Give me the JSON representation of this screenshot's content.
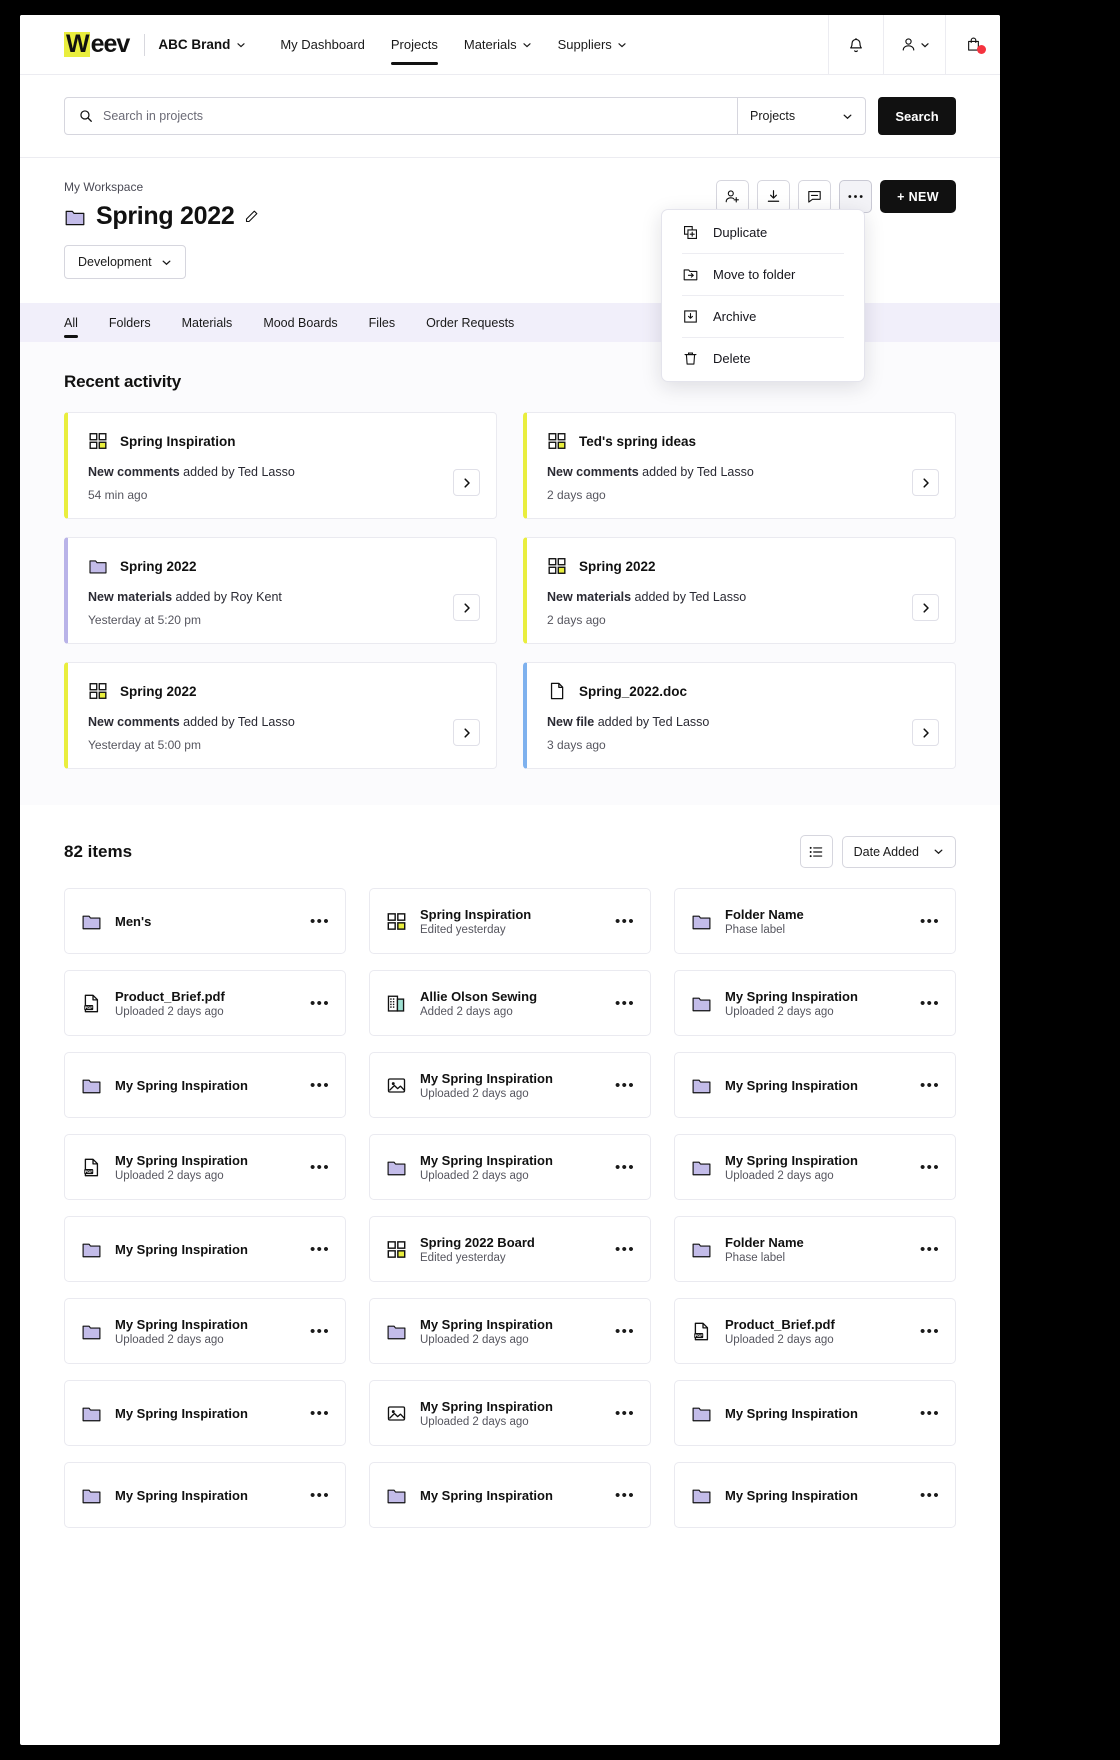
{
  "nav": {
    "logo_w": "W",
    "logo_rest": "eev",
    "brand": "ABC Brand",
    "items": [
      {
        "label": "My Dashboard",
        "caret": false,
        "active": false
      },
      {
        "label": "Projects",
        "caret": false,
        "active": true
      },
      {
        "label": "Materials",
        "caret": true,
        "active": false
      },
      {
        "label": "Suppliers",
        "caret": true,
        "active": false
      }
    ],
    "icons": {
      "bell": "bell-icon",
      "account": "account-icon",
      "bag": "shopping-bag-icon"
    }
  },
  "search": {
    "placeholder": "Search in projects",
    "scope": "Projects",
    "button": "Search"
  },
  "header": {
    "breadcrumb": "My Workspace",
    "title": "Spring 2022",
    "phase": "Development",
    "new_button": "+ NEW",
    "actions": [
      "share-icon",
      "download-icon",
      "comment-icon",
      "more-icon"
    ]
  },
  "dropdown": {
    "items": [
      {
        "label": "Duplicate",
        "icon": "duplicate-icon"
      },
      {
        "label": "Move to folder",
        "icon": "move-to-folder-icon"
      },
      {
        "label": "Archive",
        "icon": "archive-icon"
      },
      {
        "label": "Delete",
        "icon": "trash-icon"
      }
    ]
  },
  "tabs": [
    {
      "label": "All",
      "active": true
    },
    {
      "label": "Folders",
      "active": false
    },
    {
      "label": "Materials",
      "active": false
    },
    {
      "label": "Mood Boards",
      "active": false
    },
    {
      "label": "Files",
      "active": false
    },
    {
      "label": "Order Requests",
      "active": false
    }
  ],
  "recent": {
    "title": "Recent activity",
    "cards": [
      {
        "icon": "moodboard-icon",
        "accent": "yellow",
        "name": "Spring Inspiration",
        "bold": "New comments",
        "rest": " added by Ted Lasso",
        "time": "54 min ago"
      },
      {
        "icon": "moodboard-icon",
        "accent": "yellow",
        "name": "Ted's spring ideas",
        "bold": "New comments",
        "rest": " added by Ted Lasso",
        "time": "2 days ago"
      },
      {
        "icon": "folder-icon",
        "accent": "purple",
        "name": "Spring 2022",
        "bold": "New materials",
        "rest": " added by Roy Kent",
        "time": "Yesterday at 5:20 pm"
      },
      {
        "icon": "moodboard-icon",
        "accent": "yellow",
        "name": "Spring 2022",
        "bold": "New materials",
        "rest": " added by Ted Lasso",
        "time": "2 days ago"
      },
      {
        "icon": "moodboard-icon",
        "accent": "yellow",
        "name": "Spring 2022",
        "bold": "New comments",
        "rest": " added by Ted Lasso",
        "time": "Yesterday at 5:00 pm"
      },
      {
        "icon": "file-icon",
        "accent": "blue",
        "name": "Spring_2022.doc",
        "bold": "New file",
        "rest": " added by Ted Lasso",
        "time": "3 days ago"
      }
    ]
  },
  "items": {
    "count_label": "82 items",
    "view_icon": "list-view-icon",
    "sort_label": "Date Added",
    "cards": [
      {
        "icon": "folder-icon",
        "name": "Men's",
        "sub": ""
      },
      {
        "icon": "moodboard-icon",
        "name": "Spring Inspiration",
        "sub": "Edited yesterday"
      },
      {
        "icon": "folder-icon",
        "name": "Folder Name",
        "sub": "Phase label"
      },
      {
        "icon": "pdf-icon",
        "name": "Product_Brief.pdf",
        "sub": "Uploaded 2 days ago"
      },
      {
        "icon": "supplier-icon",
        "name": "Allie Olson Sewing",
        "sub": "Added 2 days ago"
      },
      {
        "icon": "folder-icon",
        "name": "My Spring Inspiration",
        "sub": "Uploaded 2 days ago"
      },
      {
        "icon": "folder-icon",
        "name": "My Spring Inspiration",
        "sub": ""
      },
      {
        "icon": "image-icon",
        "name": "My Spring Inspiration",
        "sub": "Uploaded 2 days ago"
      },
      {
        "icon": "folder-icon",
        "name": "My Spring Inspiration",
        "sub": ""
      },
      {
        "icon": "pdf-icon",
        "name": "My Spring Inspiration",
        "sub": "Uploaded 2 days ago"
      },
      {
        "icon": "folder-icon",
        "name": "My Spring Inspiration",
        "sub": "Uploaded 2 days ago"
      },
      {
        "icon": "folder-icon",
        "name": "My Spring Inspiration",
        "sub": "Uploaded 2 days ago"
      },
      {
        "icon": "folder-icon",
        "name": "My Spring Inspiration",
        "sub": ""
      },
      {
        "icon": "moodboard-icon",
        "name": "Spring 2022 Board",
        "sub": "Edited yesterday"
      },
      {
        "icon": "folder-icon",
        "name": "Folder Name",
        "sub": "Phase label"
      },
      {
        "icon": "folder-icon",
        "name": "My Spring Inspiration",
        "sub": "Uploaded 2 days ago"
      },
      {
        "icon": "folder-icon",
        "name": "My Spring Inspiration",
        "sub": "Uploaded 2 days ago"
      },
      {
        "icon": "pdf-icon",
        "name": "Product_Brief.pdf",
        "sub": "Uploaded 2 days ago"
      },
      {
        "icon": "folder-icon",
        "name": "My Spring Inspiration",
        "sub": ""
      },
      {
        "icon": "image-icon",
        "name": "My Spring Inspiration",
        "sub": "Uploaded 2 days ago"
      },
      {
        "icon": "folder-icon",
        "name": "My Spring Inspiration",
        "sub": ""
      },
      {
        "icon": "folder-icon",
        "name": "My Spring Inspiration",
        "sub": ""
      },
      {
        "icon": "folder-icon",
        "name": "My Spring Inspiration",
        "sub": ""
      },
      {
        "icon": "folder-icon",
        "name": "My Spring Inspiration",
        "sub": ""
      }
    ],
    "more_glyph": "•••"
  },
  "colors": {
    "accent_yellow": "#e9ee3e",
    "folder_purple": "#c3bce9",
    "card_blue": "#7eb1ee",
    "badge_red": "#f5333f",
    "tabs_bg": "#f1effa"
  }
}
